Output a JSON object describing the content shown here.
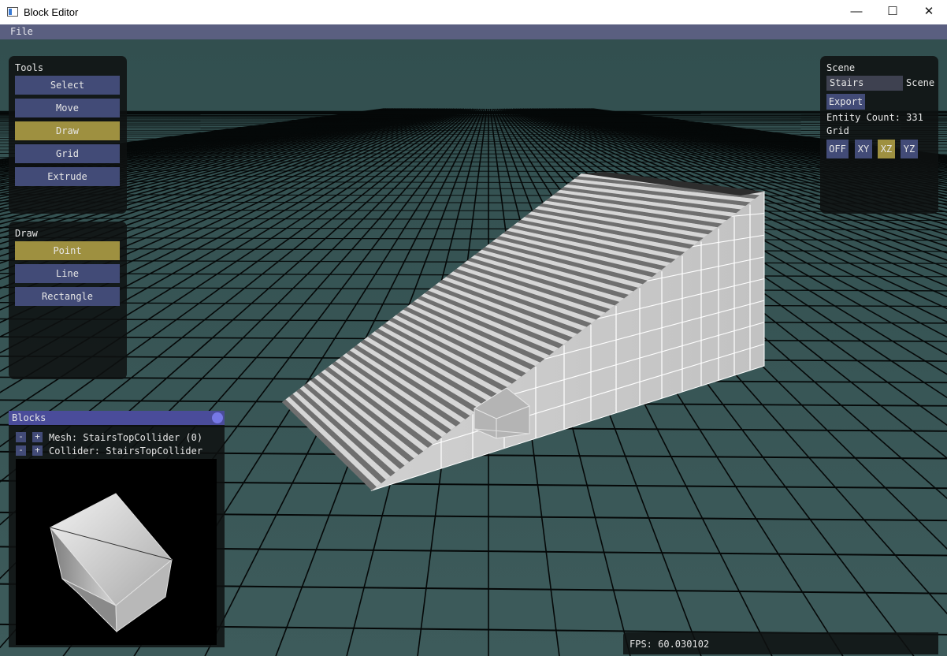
{
  "window": {
    "title": "Block Editor",
    "minimize_glyph": "—",
    "maximize_glyph": "☐",
    "close_glyph": "✕"
  },
  "menu": {
    "file": "File"
  },
  "tools": {
    "title": "Tools",
    "buttons": [
      "Select",
      "Move",
      "Draw",
      "Grid",
      "Extrude"
    ],
    "active": "Draw"
  },
  "draw": {
    "title": "Draw",
    "buttons": [
      "Point",
      "Line",
      "Rectangle"
    ],
    "active": "Point"
  },
  "scene": {
    "title": "Scene",
    "name_value": "Stairs",
    "name_label": "Scene",
    "export_label": "Export",
    "entity_count": "Entity Count: 331",
    "grid_label": "Grid",
    "grid_buttons": [
      "OFF",
      "XY",
      "XZ",
      "YZ"
    ],
    "grid_active": "XZ"
  },
  "blocks": {
    "title": "Blocks",
    "rows": [
      {
        "minus": "-",
        "plus": "+",
        "text": "Mesh: StairsTopCollider (0)"
      },
      {
        "minus": "-",
        "plus": "+",
        "text": "Collider: StairsTopCollider"
      }
    ]
  },
  "status": {
    "fps": "FPS: 60.030102"
  },
  "colors": {
    "viewport_bg": "#3c5a5a",
    "button": "#424b77",
    "button_active": "#9e9040",
    "panel_header": "#4a4c9a",
    "menubar": "#5a5f80"
  }
}
